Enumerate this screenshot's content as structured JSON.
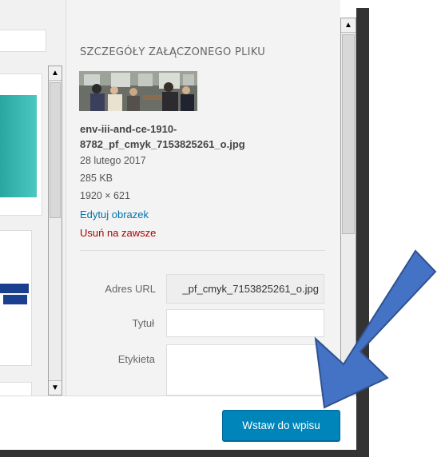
{
  "details": {
    "heading": "SZCZEGÓŁY ZAŁĄCZONEGO PLIKU",
    "filename": "env-iii-and-ce-1910-8782_pf_cmyk_7153825261_o.jpg",
    "date": "28 lutego 2017",
    "size": "285 KB",
    "dimensions": "1920 × 621",
    "edit_link": "Edytuj obrazek",
    "delete_link": "Usuń na zawsze"
  },
  "form": {
    "url_label": "Adres URL",
    "url_value": "_pf_cmyk_7153825261_o.jpg",
    "title_label": "Tytuł",
    "title_value": "",
    "alt_label": "Etykieta",
    "alt_value": ""
  },
  "toolbar": {
    "insert_label": "Wstaw do wpisu"
  },
  "scroll": {
    "up_arrow": "▲",
    "down_arrow": "▼"
  },
  "colors": {
    "primary_button": "#0085ba",
    "link": "#0073aa",
    "delete": "#aa0000",
    "annotation_arrow": "#4472c4"
  },
  "icons": {
    "annotation": "blue-arrow-pointing-down-left"
  }
}
